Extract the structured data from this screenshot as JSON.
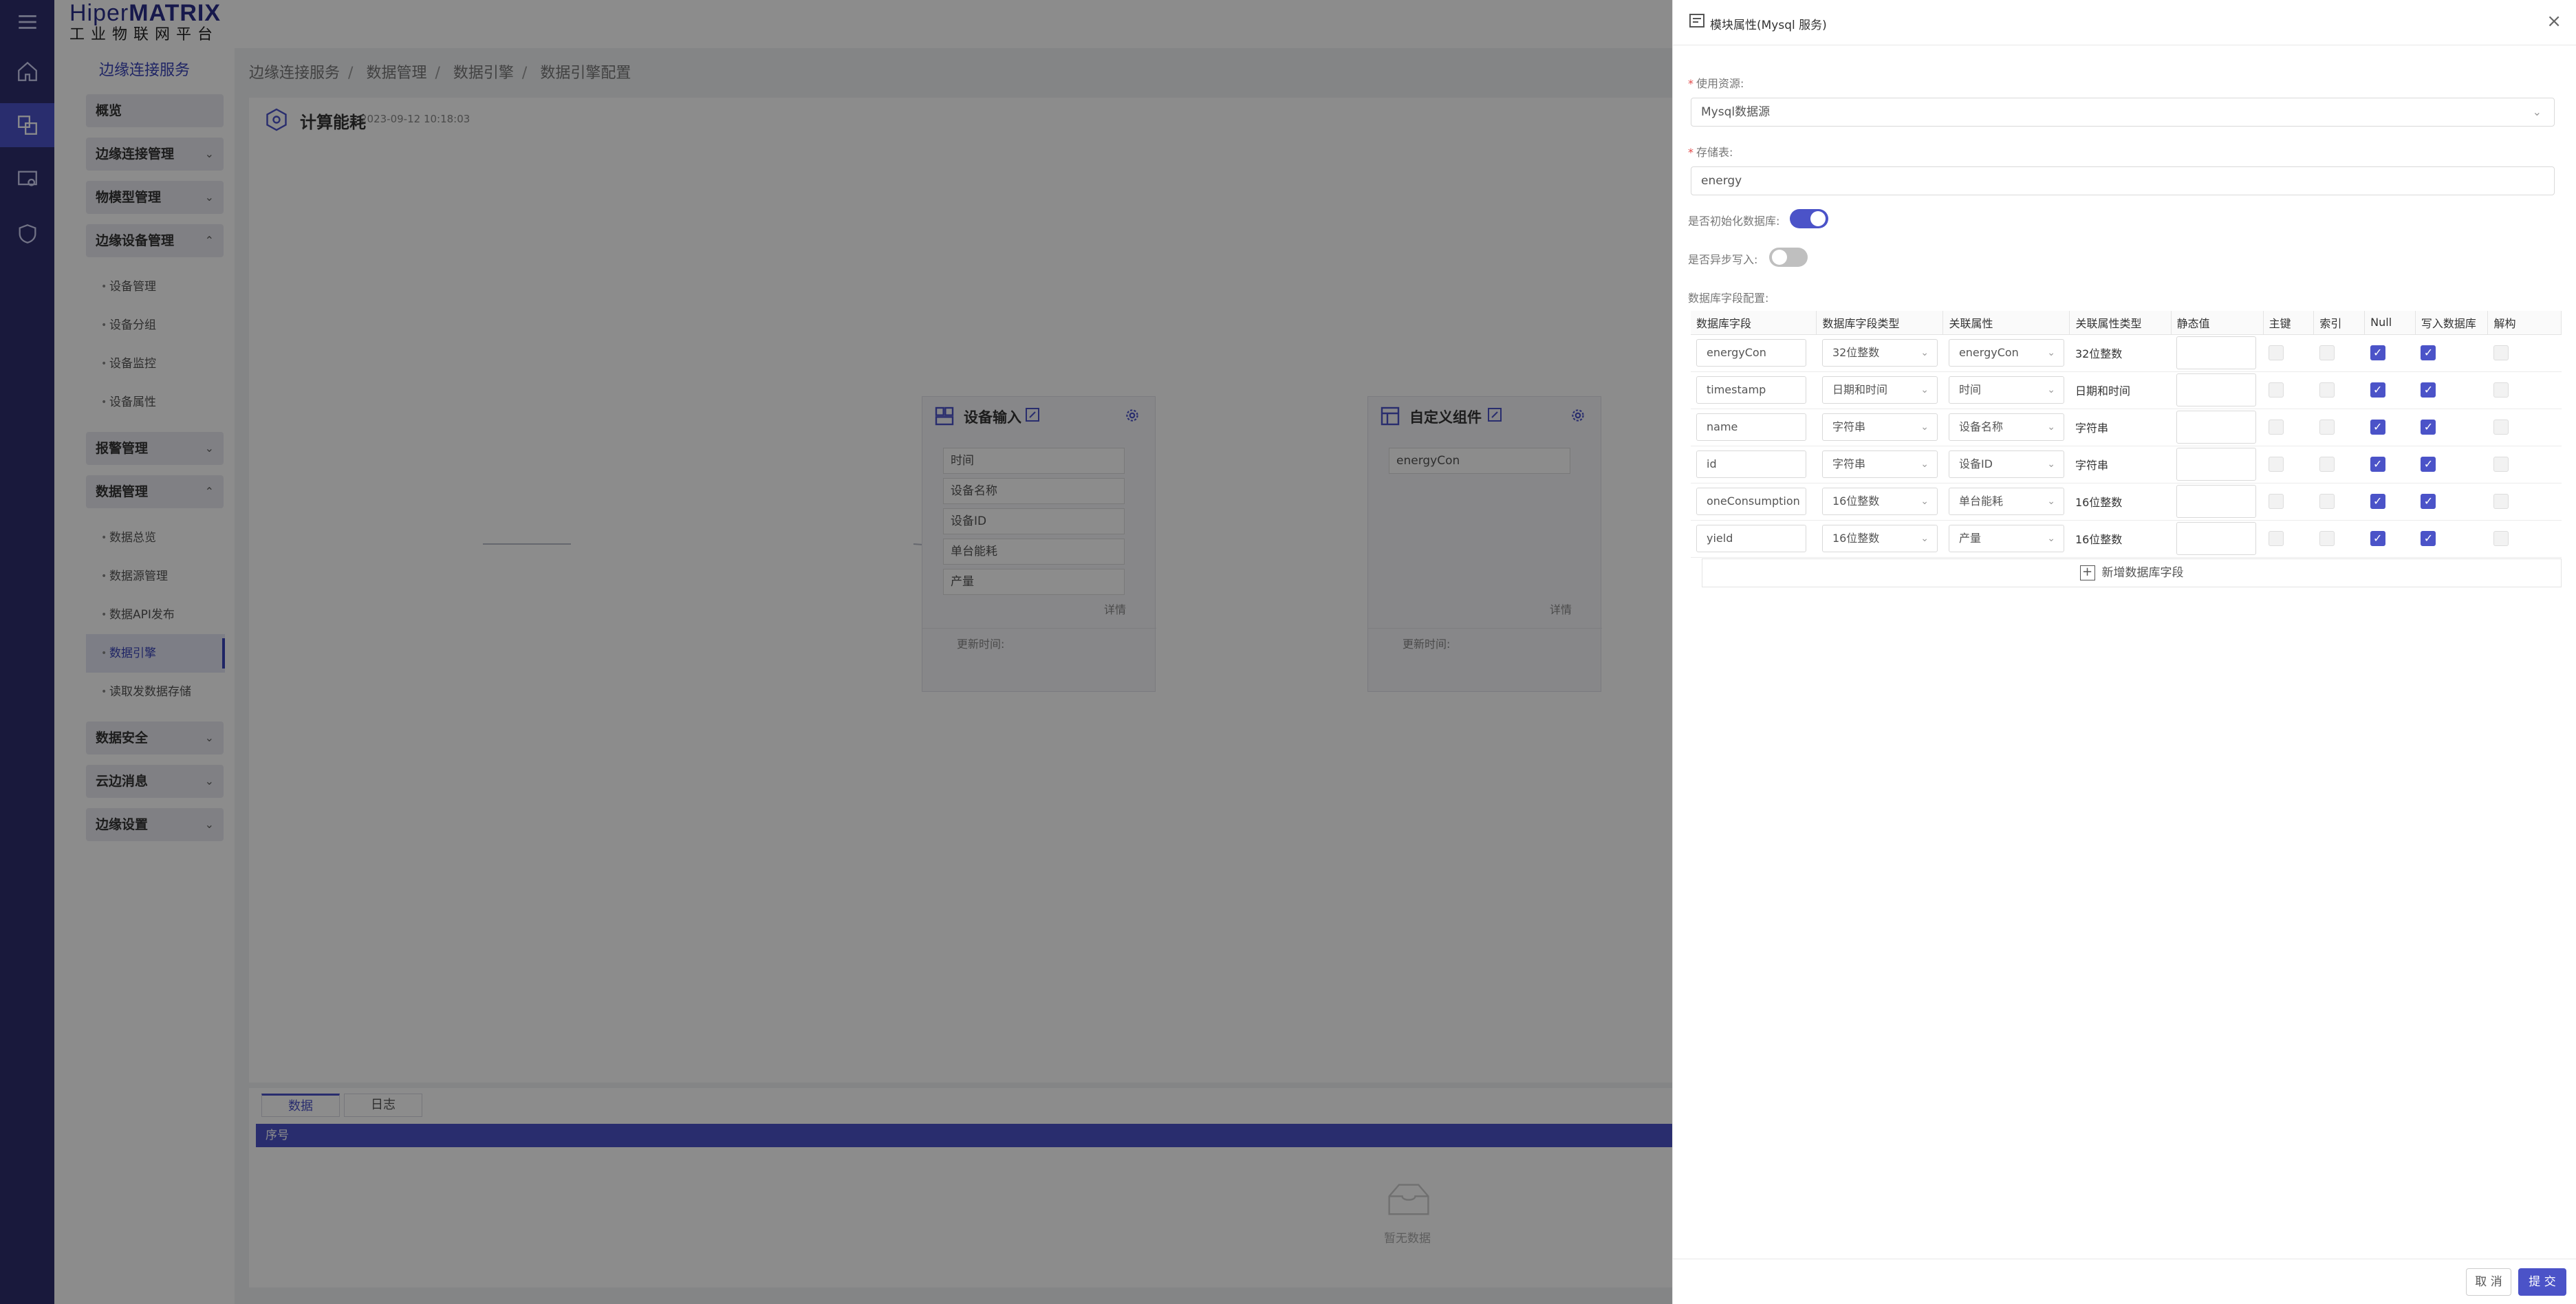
{
  "logo": {
    "brand_a": "Hiper",
    "brand_b": "MATRIX",
    "subtitle": "工业物联网平台"
  },
  "sidebar": {
    "title": "边缘连接服务",
    "groups": [
      {
        "label": "概览"
      },
      {
        "label": "边缘连接管理"
      },
      {
        "label": "物模型管理"
      },
      {
        "label": "边缘设备管理"
      },
      {
        "label": "报警管理"
      },
      {
        "label": "数据管理"
      },
      {
        "label": "数据安全"
      },
      {
        "label": "云边消息"
      },
      {
        "label": "边缘设置"
      }
    ],
    "device_subs": [
      "设备管理",
      "设备分组",
      "设备监控",
      "设备属性"
    ],
    "data_subs": [
      "数据总览",
      "数据源管理",
      "数据API发布",
      "数据引擎",
      "读取发数据存储"
    ]
  },
  "breadcrumb": [
    "边缘连接服务",
    "数据管理",
    "数据引擎",
    "数据引擎配置"
  ],
  "card": {
    "title": "计算能耗",
    "date": "2023-09-12 10:18:03"
  },
  "node1": {
    "title": "设备输入",
    "fields": [
      "时间",
      "设备名称",
      "设备ID",
      "单台能耗",
      "产量"
    ],
    "detail": "详情",
    "update": "更新时间:"
  },
  "node2": {
    "title": "自定义组件",
    "fields": [
      "energyCon"
    ],
    "detail": "详情",
    "update": "更新时间:"
  },
  "bottom": {
    "tabs": [
      "数据",
      "日志"
    ],
    "col": "序号",
    "empty": "暂无数据"
  },
  "drawer": {
    "title": "模块属性(Mysql 服务)",
    "close": "×",
    "source_label": "使用资源:",
    "source_value": "Mysql数据源",
    "table_label": "存储表:",
    "table_value": "energy",
    "init_label": "是否初始化数据库:",
    "async_label": "是否异步写入:",
    "fields_label": "数据库字段配置:",
    "columns": [
      "数据库字段",
      "数据库字段类型",
      "关联属性",
      "关联属性类型",
      "静态值",
      "主键",
      "索引",
      "Null",
      "写入数据库",
      "解构"
    ],
    "rows": [
      {
        "field": "energyCon",
        "type": "32位整数",
        "attr": "energyCon",
        "attr_type": "32位整数"
      },
      {
        "field": "timestamp",
        "type": "日期和时间",
        "attr": "时间",
        "attr_type": "日期和时间"
      },
      {
        "field": "name",
        "type": "字符串",
        "attr": "设备名称",
        "attr_type": "字符串"
      },
      {
        "field": "id",
        "type": "字符串",
        "attr": "设备ID",
        "attr_type": "字符串"
      },
      {
        "field": "oneConsumption",
        "type": "16位整数",
        "attr": "单台能耗",
        "attr_type": "16位整数"
      },
      {
        "field": "yield",
        "type": "16位整数",
        "attr": "产量",
        "attr_type": "16位整数"
      }
    ],
    "add_label": "新增数据库字段",
    "cancel": "取 消",
    "submit": "提 交"
  },
  "colors": {
    "accent": "#4b53c8",
    "rail": "#2f2f6e",
    "required": "#e24b4b"
  }
}
